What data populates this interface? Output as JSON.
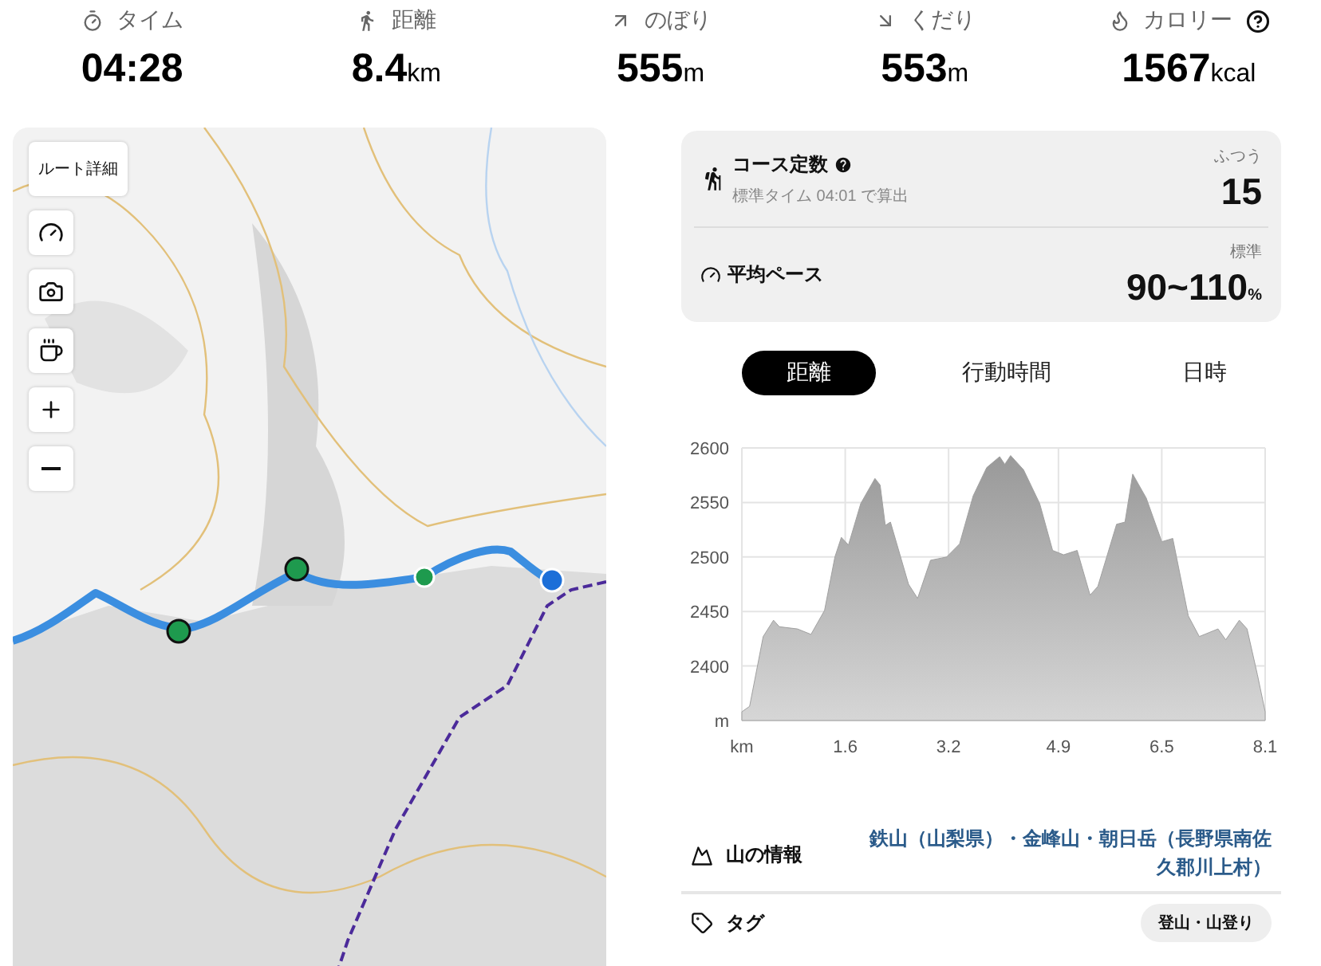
{
  "stats": [
    {
      "kind": "time",
      "label": "タイム",
      "value": "04:28",
      "help": false
    },
    {
      "kind": "distance",
      "label": "距離",
      "value": "8.4",
      "unit": "km",
      "help": false
    },
    {
      "kind": "ascent",
      "label": "のぼり",
      "value": "555",
      "unit": "m",
      "help": false
    },
    {
      "kind": "descent",
      "label": "くだり",
      "value": "553",
      "unit": "m",
      "help": false
    },
    {
      "kind": "calories",
      "label": "カロリー",
      "value": "1567",
      "unit": "kcal",
      "help": true
    }
  ],
  "map": {
    "controls": [
      {
        "kind": "text",
        "label": "ルート詳細"
      },
      {
        "kind": "pace"
      },
      {
        "kind": "camera"
      },
      {
        "kind": "cup"
      },
      {
        "kind": "zoom_in"
      },
      {
        "kind": "zoom_out"
      }
    ]
  },
  "course_card": {
    "rows": [
      {
        "kind": "course_constant",
        "title": "コース定数",
        "help": true,
        "note": "標準タイム 04:01 で算出",
        "grade": "ふつう",
        "value": "15"
      },
      {
        "kind": "pace",
        "title": "平均ペース",
        "help": false,
        "grade": "標準",
        "value": "90~110",
        "unit": "%"
      }
    ]
  },
  "tabs": [
    {
      "label": "距離",
      "selected": true
    },
    {
      "label": "行動時間",
      "selected": false
    },
    {
      "label": "日時",
      "selected": false
    }
  ],
  "elevation": {
    "chart_data": {
      "type": "area",
      "xlim": [
        0,
        8.1
      ],
      "ylim": [
        2350,
        2600
      ],
      "xticks": [
        {
          "value": 0,
          "label": "km"
        },
        1.6,
        3.2,
        4.9,
        6.5,
        8.1
      ],
      "yticks": [
        {
          "value": 2350,
          "label": "m"
        },
        2400,
        2450,
        2500,
        2550,
        2600
      ],
      "x": [
        0,
        0.12,
        0.33,
        0.49,
        0.58,
        0.86,
        1.07,
        1.28,
        1.44,
        1.54,
        1.65,
        1.84,
        2.06,
        2.14,
        2.22,
        2.3,
        2.58,
        2.72,
        2.92,
        3.09,
        3.17,
        3.37,
        3.58,
        3.79,
        3.99,
        4.07,
        4.16,
        4.36,
        4.61,
        4.81,
        4.98,
        5.19,
        5.39,
        5.51,
        5.8,
        5.93,
        6.05,
        6.26,
        6.5,
        6.67,
        6.91,
        7.08,
        7.37,
        7.49,
        7.7,
        7.82,
        7.98,
        8.1
      ],
      "grid": true,
      "series": [
        {
          "color": "#a0a0a0",
          "values": [
            2358,
            2363,
            2427,
            2442,
            2436,
            2434,
            2429,
            2451,
            2500,
            2518,
            2511,
            2549,
            2572,
            2566,
            2529,
            2532,
            2475,
            2462,
            2497,
            2499,
            2500,
            2512,
            2556,
            2582,
            2592,
            2585,
            2593,
            2580,
            2549,
            2506,
            2502,
            2506,
            2465,
            2473,
            2530,
            2532,
            2576,
            2554,
            2514,
            2517,
            2446,
            2427,
            2434,
            2424,
            2442,
            2434,
            2392,
            2358
          ]
        }
      ]
    }
  },
  "info": [
    {
      "kind": "mountain",
      "label": "山の情報",
      "link": "鉄山（山梨県）・金峰山・朝日岳（長野県南佐久郡川上村）"
    },
    {
      "kind": "tag",
      "label": "タグ",
      "tags": [
        "登山・山登り"
      ]
    }
  ]
}
